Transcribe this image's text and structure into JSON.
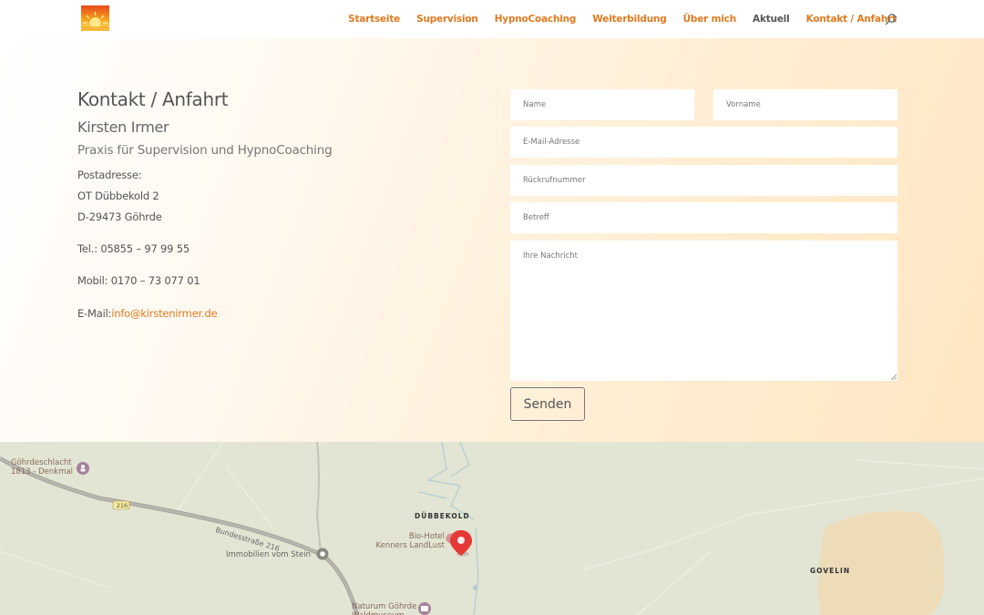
{
  "header": {
    "nav": [
      {
        "label": "Startseite",
        "style": "accent"
      },
      {
        "label": "Supervision",
        "style": "accent"
      },
      {
        "label": "HypnoCoaching",
        "style": "accent"
      },
      {
        "label": "Weiterbildung",
        "style": "accent"
      },
      {
        "label": "Über mich",
        "style": "accent"
      },
      {
        "label": "Aktuell",
        "style": "plain"
      },
      {
        "label": "Kontakt / Anfahrt",
        "style": "accent"
      }
    ],
    "accent_color": "#e07a1f"
  },
  "contact": {
    "title": "Kontakt / Anfahrt",
    "name": "Kirsten Irmer",
    "tagline": "Praxis für Supervision und HypnoCoaching",
    "address_label": "Postadresse:",
    "street": "OT Dübbekold 2",
    "city": "D-29473 Göhrde",
    "phone": "Tel.: 05855 – 97 99 55",
    "mobile": "Mobil: 0170 – 73 077 01",
    "email_label": "E-Mail:",
    "email": "info@kirstenirmer.de"
  },
  "form": {
    "name_placeholder": "Name",
    "firstname_placeholder": "Vorname",
    "email_placeholder": "E-Mail-Adresse",
    "callback_placeholder": "Rückrufnummer",
    "subject_placeholder": "Betreff",
    "message_placeholder": "Ihre Nachricht",
    "submit_label": "Senden"
  },
  "map": {
    "labels": {
      "monument": "Göhrdeschlacht\n1813 - Denkmal",
      "road_shield": "216",
      "road_name": "Bundesstraße 216",
      "village": "DÜBBEKOLD",
      "hotel": "Bio-Hotel\nKenners LandLust",
      "realestate": "Immobilien vom Stein",
      "museum": "Naturum Göhrde\nWaldmuseum",
      "govelin": "GOVELIN"
    },
    "marker_color": "#e53935"
  }
}
